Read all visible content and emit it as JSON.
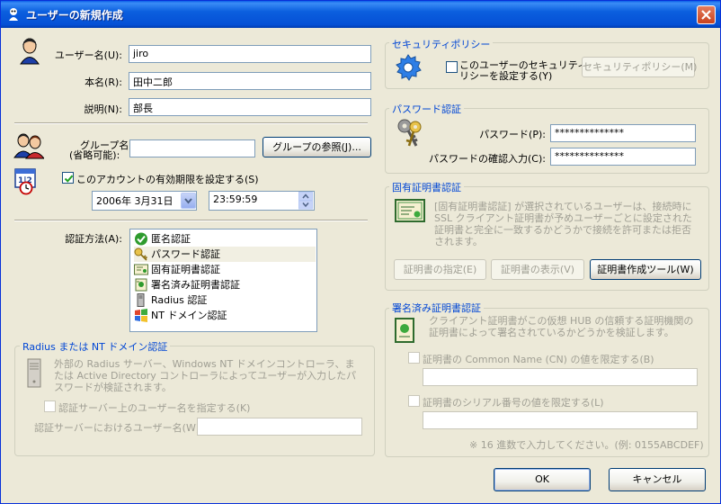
{
  "window": {
    "title": "ユーザーの新規作成"
  },
  "user": {
    "username_label": "ユーザー名(U):",
    "username_value": "jiro",
    "realname_label": "本名(R):",
    "realname_value": "田中二郎",
    "description_label": "説明(N):",
    "description_value": "部長",
    "group_label_line1": "グループ名",
    "group_label_line2": "(省略可能):",
    "group_value": "",
    "group_browse_button": "グループの参照(J)..."
  },
  "expiry": {
    "checkbox_label": "このアカウントの有効期限を設定する(S)",
    "checked": true,
    "date_value": "2006年  3月31日",
    "time_value": "23:59:59"
  },
  "auth": {
    "label": "認証方法(A):",
    "methods": [
      {
        "label": "匿名認証",
        "icon": "green-check-icon"
      },
      {
        "label": "パスワード認証",
        "icon": "key-icon",
        "selected": true
      },
      {
        "label": "固有証明書認証",
        "icon": "certificate-icon"
      },
      {
        "label": "署名済み証明書認証",
        "icon": "signed-certificate-icon"
      },
      {
        "label": "Radius 認証",
        "icon": "server-icon"
      },
      {
        "label": "NT ドメイン認証",
        "icon": "nt-domain-icon"
      }
    ]
  },
  "radius": {
    "group_title": "Radius または NT ドメイン認証",
    "description": "外部の Radius サーバー、Windows NT ドメインコントローラ、または Active Directory コントローラによってユーザーが入力したパスワードが検証されます。",
    "checkbox_label": "認証サーバー上のユーザー名を指定する(K)",
    "username_label": "認証サーバーにおけるユーザー名(W):",
    "username_value": ""
  },
  "policy": {
    "group_title": "セキュリティポリシー",
    "checkbox_line1": "このユーザーのセキュリティポ",
    "checkbox_line2": "リシーを設定する(Y)",
    "button": "セキュリティポリシー(M)"
  },
  "password": {
    "group_title": "パスワード認証",
    "password_label": "パスワード(P):",
    "password_value": "**************",
    "confirm_label": "パスワードの確認入力(C):",
    "confirm_value": "**************"
  },
  "cert": {
    "group_title": "固有証明書認証",
    "description": "[固有証明書認証] が選択されているユーザーは、接続時に SSL クライアント証明書が予めユーザーごとに設定された証明書と完全に一致するかどうかで接続を許可または拒否されます。",
    "specify_button": "証明書の指定(E)",
    "view_button": "証明書の表示(V)",
    "create_button": "証明書作成ツール(W)"
  },
  "signed": {
    "group_title": "署名済み証明書認証",
    "description": "クライアント証明書がこの仮想 HUB の信頼する証明機関の証明書によって署名されているかどうかを検証します。",
    "cn_checkbox": "証明書の Common Name (CN) の値を限定する(B)",
    "cn_value": "",
    "serial_checkbox": "証明書のシリアル番号の値を限定する(L)",
    "serial_value": "",
    "hint": "※ 16 進数で入力してください。(例: 0155ABCDEF)"
  },
  "footer": {
    "ok_button": "OK",
    "cancel_button": "キャンセル"
  },
  "colors": {
    "titlebar": "#0A5FE8",
    "group_title": "#0046D5",
    "disabled_text": "#A09F94",
    "face": "#ECE9D8"
  }
}
